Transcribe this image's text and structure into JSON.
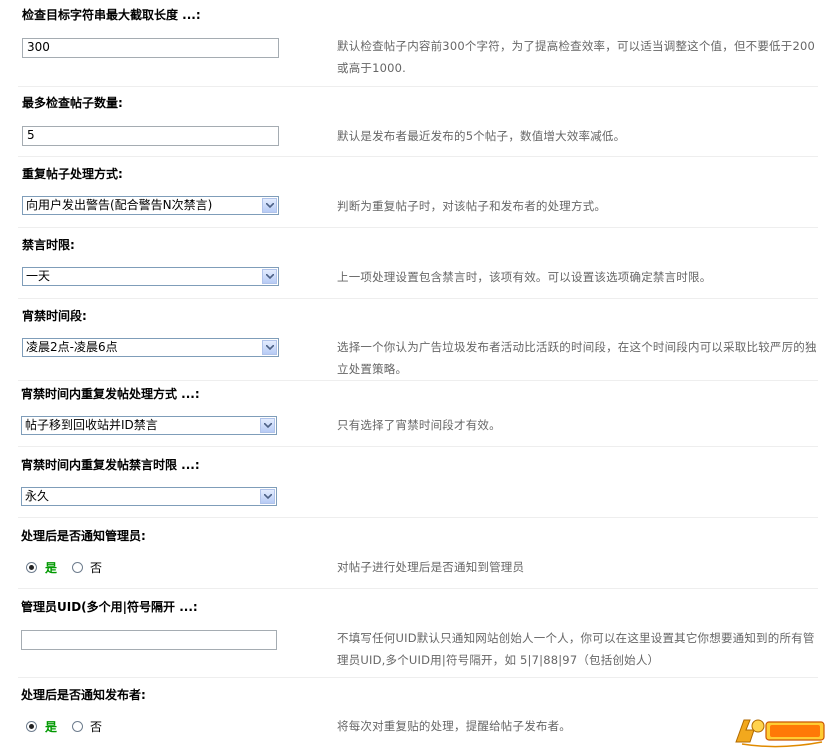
{
  "settings": {
    "max_length": {
      "title": "检查目标字符串最大截取长度 ...:",
      "value": "300",
      "desc": "默认检查帖子内容前300个字符，为了提高检查效率，可以适当调整这个值，但不要低于200或高于1000."
    },
    "max_posts": {
      "title": "最多检查帖子数量:",
      "value": "5",
      "desc": "默认是发布者最近发布的5个帖子，数值增大效率减低。"
    },
    "duplicate_action": {
      "title": "重复帖子处理方式:",
      "value": "向用户发出警告(配合警告N次禁言)",
      "desc": "判断为重复帖子时，对该帖子和发布者的处理方式。"
    },
    "ban_duration": {
      "title": "禁言时限:",
      "value": "一天",
      "desc": "上一项处理设置包含禁言时，该项有效。可以设置该选项确定禁言时限。"
    },
    "curfew_period": {
      "title": "宵禁时间段:",
      "value": "凌晨2点-凌晨6点",
      "desc": "选择一个你认为广告垃圾发布者活动比活跃的时间段，在这个时间段内可以采取比较严厉的独立处置策略。"
    },
    "curfew_action": {
      "title": "宵禁时间内重复发帖处理方式 ...:",
      "value": "帖子移到回收站并ID禁言",
      "desc": "只有选择了宵禁时间段才有效。"
    },
    "curfew_ban_duration": {
      "title": "宵禁时间内重复发帖禁言时限 ...:",
      "value": "永久"
    },
    "notify_admin": {
      "title": "处理后是否通知管理员:",
      "yes": "是",
      "no": "否",
      "selected": "是",
      "desc": "对帖子进行处理后是否通知到管理员"
    },
    "admin_uids": {
      "title": "管理员UID(多个用|符号隔开 ...:",
      "value": "",
      "desc": "不填写任何UID默认只通知网站创始人一个人，你可以在这里设置其它你想要通知到的所有管理员UID,多个UID用|符号隔开，如 5|7|88|97（包括创始人）"
    },
    "notify_poster": {
      "title": "处理后是否通知发布者:",
      "yes": "是",
      "no": "否",
      "selected": "是",
      "desc": "将每次对重复贴的处理，提醒给帖子发布者。"
    }
  },
  "logo_icon": "aihaobang-logo",
  "colors": {
    "selected_radio_label": "#009900",
    "description_text": "#666666"
  }
}
